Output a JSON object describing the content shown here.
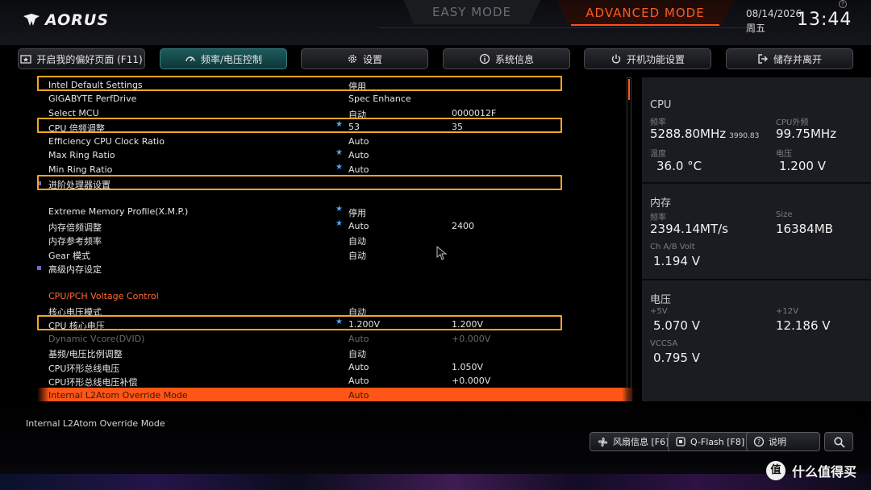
{
  "header": {
    "brand": "AORUS",
    "easy_mode": "EASY MODE",
    "advanced_mode": "ADVANCED MODE",
    "date": "08/14/2026",
    "weekday": "周五",
    "time": "13:44",
    "accent_color": "#ff5a1f"
  },
  "tabs": [
    {
      "label": "开启我的偏好页面 (F11)",
      "icon": "favorite-icon",
      "active": false
    },
    {
      "label": "频率/电压控制",
      "icon": "gauge-icon",
      "active": true
    },
    {
      "label": "设置",
      "icon": "gear-icon",
      "active": false
    },
    {
      "label": "系统信息",
      "icon": "info-icon",
      "active": false
    },
    {
      "label": "开机功能设置",
      "icon": "power-icon",
      "active": false
    },
    {
      "label": "储存并离开",
      "icon": "exit-icon",
      "active": false
    }
  ],
  "settings": [
    {
      "name": "Intel Default Settings",
      "star": false,
      "v1": "停用",
      "v2": ""
    },
    {
      "name": "GIGABYTE PerfDrive",
      "star": false,
      "v1": "Spec Enhance",
      "v2": ""
    },
    {
      "name": "Select MCU",
      "star": false,
      "v1": "自动",
      "v2": "0000012F"
    },
    {
      "name": "CPU 倍频调整",
      "star": true,
      "v1": "53",
      "v2": "35"
    },
    {
      "name": "Efficiency CPU Clock Ratio",
      "star": false,
      "v1": "Auto",
      "v2": ""
    },
    {
      "name": "Max Ring Ratio",
      "star": true,
      "v1": "Auto",
      "v2": ""
    },
    {
      "name": "Min Ring Ratio",
      "star": true,
      "v1": "Auto",
      "v2": ""
    },
    {
      "name": "进阶处理器设置",
      "star": false,
      "v1": "",
      "v2": "",
      "submenu": true
    },
    {
      "name": "Extreme Memory Profile(X.M.P.)",
      "star": true,
      "v1": "停用",
      "v2": ""
    },
    {
      "name": "内存倍频调整",
      "star": true,
      "v1": "Auto",
      "v2": "2400"
    },
    {
      "name": "内存参考频率",
      "star": false,
      "v1": "自动",
      "v2": ""
    },
    {
      "name": "Gear 模式",
      "star": false,
      "v1": "自动",
      "v2": ""
    },
    {
      "name": "高级内存设定",
      "star": false,
      "v1": "",
      "v2": "",
      "submenu": true
    },
    {
      "name": "CPU/PCH Voltage Control",
      "star": false,
      "v1": "",
      "v2": "",
      "header": true
    },
    {
      "name": "核心电压模式",
      "star": false,
      "v1": "自动",
      "v2": ""
    },
    {
      "name": "CPU 核心电压",
      "star": true,
      "v1": "1.200V",
      "v2": "1.200V"
    },
    {
      "name": "Dynamic Vcore(DVID)",
      "star": false,
      "v1": "Auto",
      "v2": "+0.000V",
      "dim": true
    },
    {
      "name": "基频/电压比例调整",
      "star": false,
      "v1": "自动",
      "v2": ""
    },
    {
      "name": "CPU环形总线电压",
      "star": false,
      "v1": "Auto",
      "v2": "1.050V"
    },
    {
      "name": "CPU环形总线电压补偿",
      "star": false,
      "v1": "Auto",
      "v2": "+0.000V"
    },
    {
      "name": "Internal L2Atom Override Mode",
      "star": false,
      "v1": "Auto",
      "v2": "",
      "selected": true
    }
  ],
  "info": {
    "cpu": {
      "title": "CPU",
      "freq_label": "频率",
      "freq_value": "5288.80MHz",
      "freq_sub": "3990.83",
      "ext_label": "CPU外频",
      "ext_value": "99.75MHz",
      "temp_label": "温度",
      "temp_value": "36.0 °C",
      "volt_label": "电压",
      "volt_value": "1.200 V"
    },
    "memory": {
      "title": "内存",
      "freq_label": "频率",
      "freq_value": "2394.14MT/s",
      "size_label": "Size",
      "size_value": "16384MB",
      "chab_label": "Ch A/B Volt",
      "chab_value": "1.194 V"
    },
    "voltage": {
      "title": "电压",
      "v5_label": "+5V",
      "v5_value": "5.070 V",
      "v12_label": "+12V",
      "v12_value": "12.186 V",
      "vccsa_label": "VCCSA",
      "vccsa_value": "0.795 V"
    }
  },
  "footer": {
    "help_text": "Internal L2Atom Override Mode",
    "fan_button": "风扇信息 [F6]",
    "qflash_button": "Q-Flash [F8]",
    "help_button": "说明",
    "watermark_badge": "值",
    "watermark_text": "什么值得买"
  }
}
